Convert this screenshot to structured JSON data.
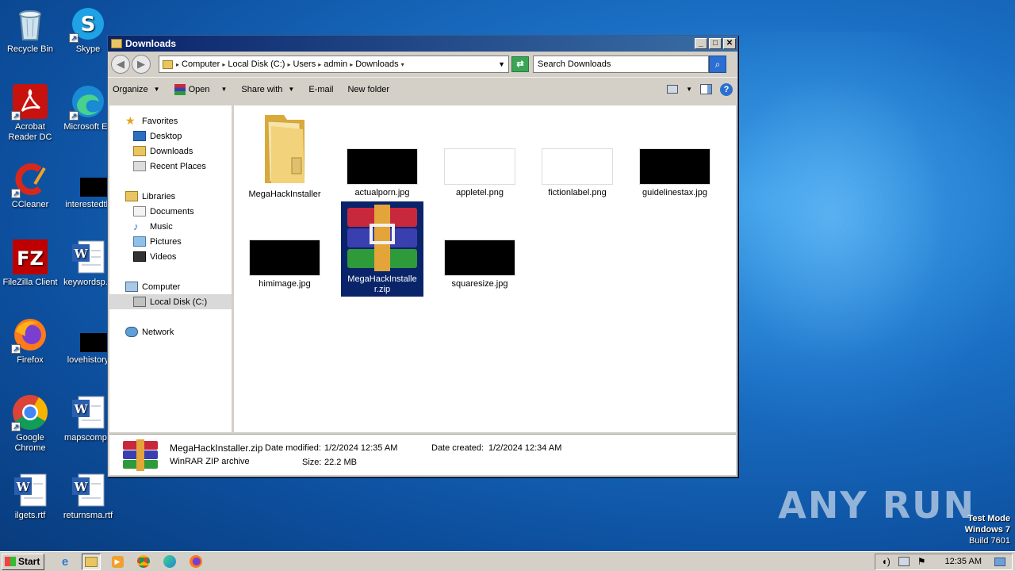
{
  "desktop": {
    "icons": [
      {
        "label": "Recycle Bin"
      },
      {
        "label": "Skype"
      },
      {
        "label": "Acrobat Reader DC"
      },
      {
        "label": "Microsoft Ed"
      },
      {
        "label": "CCleaner"
      },
      {
        "label": "interestedth"
      },
      {
        "label": "FileZilla Client"
      },
      {
        "label": "keywordsp..."
      },
      {
        "label": "Firefox"
      },
      {
        "label": "lovehistory"
      },
      {
        "label": "Google Chrome"
      },
      {
        "label": "mapscompu"
      },
      {
        "label": "ilgets.rtf"
      },
      {
        "label": "returnsma.rtf"
      }
    ]
  },
  "window": {
    "title": "Downloads",
    "address": {
      "crumbs": [
        "Computer",
        "Local Disk (C:)",
        "Users",
        "admin",
        "Downloads"
      ]
    },
    "search": {
      "placeholder": "Search Downloads"
    },
    "toolbar": {
      "organize": "Organize",
      "open": "Open",
      "share_with": "Share with",
      "email": "E-mail",
      "new_folder": "New folder"
    },
    "nav": {
      "favorites": "Favorites",
      "desktop": "Desktop",
      "downloads": "Downloads",
      "recent_places": "Recent Places",
      "libraries": "Libraries",
      "documents": "Documents",
      "music": "Music",
      "pictures": "Pictures",
      "videos": "Videos",
      "computer": "Computer",
      "local_disk": "Local Disk (C:)",
      "network": "Network"
    },
    "files": [
      {
        "name": "MegaHackInstaller",
        "kind": "folder"
      },
      {
        "name": "actualporn.jpg",
        "kind": "image-dark"
      },
      {
        "name": "appletel.png",
        "kind": "image-light"
      },
      {
        "name": "fictionlabel.png",
        "kind": "image-light"
      },
      {
        "name": "guidelinestax.jpg",
        "kind": "image-dark"
      },
      {
        "name": "himimage.jpg",
        "kind": "image-dark"
      },
      {
        "name": "MegaHackInstaller.zip",
        "kind": "winrar-archive",
        "selected": true
      },
      {
        "name": "squaresize.jpg",
        "kind": "image-dark"
      }
    ],
    "details": {
      "filename": "MegaHackInstaller.zip",
      "type": "WinRAR ZIP archive",
      "date_modified_label": "Date modified:",
      "date_modified": "1/2/2024 12:35 AM",
      "size_label": "Size:",
      "size": "22.2 MB",
      "date_created_label": "Date created:",
      "date_created": "1/2/2024 12:34 AM"
    }
  },
  "taskbar": {
    "start_label": "Start",
    "clock": "12:35 AM"
  },
  "watermark": {
    "text": "ANY RUN",
    "test_mode": "Test Mode",
    "os": "Windows 7",
    "build": "Build 7601"
  },
  "colors": {
    "selection": "#0a246a",
    "title_gradient_start": "#0a246a",
    "title_gradient_end": "#3a6ea5"
  }
}
